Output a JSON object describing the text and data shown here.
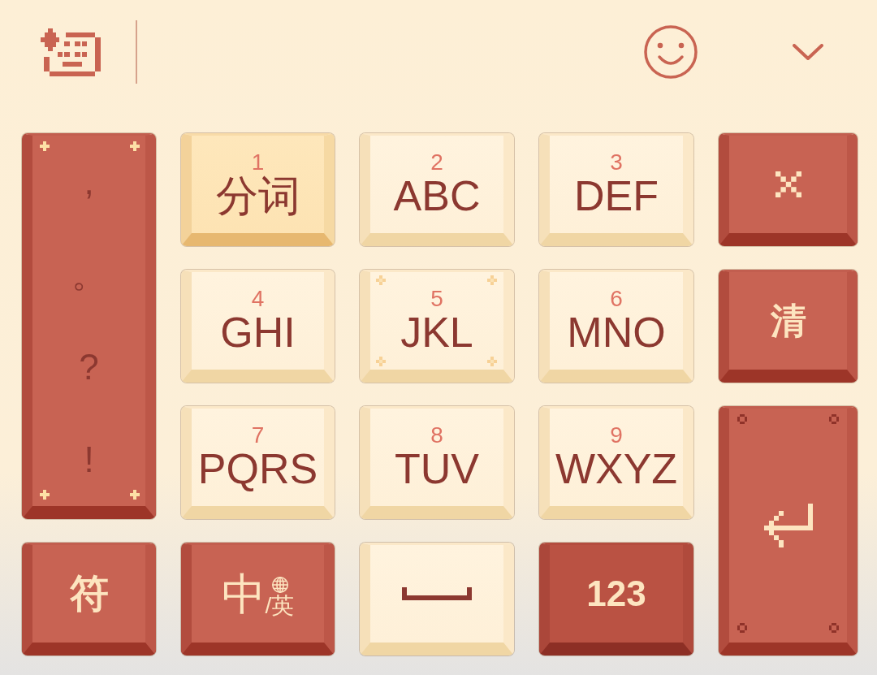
{
  "keyboard": {
    "keys": [
      {
        "kind": "punctuation",
        "symbols": [
          ",",
          "。",
          "?",
          "!"
        ],
        "highlighted": false,
        "ornaments": true
      },
      {
        "kind": "letters",
        "digit": "1",
        "letters": "分词",
        "highlighted": true,
        "ornaments": false
      },
      {
        "kind": "letters",
        "digit": "2",
        "letters": "ABC",
        "highlighted": false,
        "ornaments": false
      },
      {
        "kind": "letters",
        "digit": "3",
        "letters": "DEF",
        "highlighted": false,
        "ornaments": false
      },
      {
        "kind": "delete",
        "highlighted": false,
        "ornaments": false
      },
      {
        "kind": "letters",
        "digit": "4",
        "letters": "GHI",
        "highlighted": false,
        "ornaments": false
      },
      {
        "kind": "letters",
        "digit": "5",
        "letters": "JKL",
        "highlighted": false,
        "ornaments": true
      },
      {
        "kind": "letters",
        "digit": "6",
        "letters": "MNO",
        "highlighted": false,
        "ornaments": false
      },
      {
        "kind": "clear",
        "label": "清",
        "highlighted": false,
        "ornaments": false
      },
      {
        "kind": "letters",
        "digit": "7",
        "letters": "PQRS",
        "highlighted": false,
        "ornaments": false
      },
      {
        "kind": "letters",
        "digit": "8",
        "letters": "TUV",
        "highlighted": false,
        "ornaments": false
      },
      {
        "kind": "letters",
        "digit": "9",
        "letters": "WXYZ",
        "highlighted": false,
        "ornaments": false
      },
      {
        "kind": "enter",
        "highlighted": false,
        "ornaments": true
      },
      {
        "kind": "symbols",
        "label": "符",
        "highlighted": false,
        "ornaments": false
      },
      {
        "kind": "language",
        "label": "中",
        "sub_label": "/英",
        "highlighted": false,
        "ornaments": false
      },
      {
        "kind": "space",
        "highlighted": false,
        "ornaments": false
      },
      {
        "kind": "numbers",
        "label": "123",
        "highlighted": false,
        "ornaments": false
      }
    ]
  }
}
